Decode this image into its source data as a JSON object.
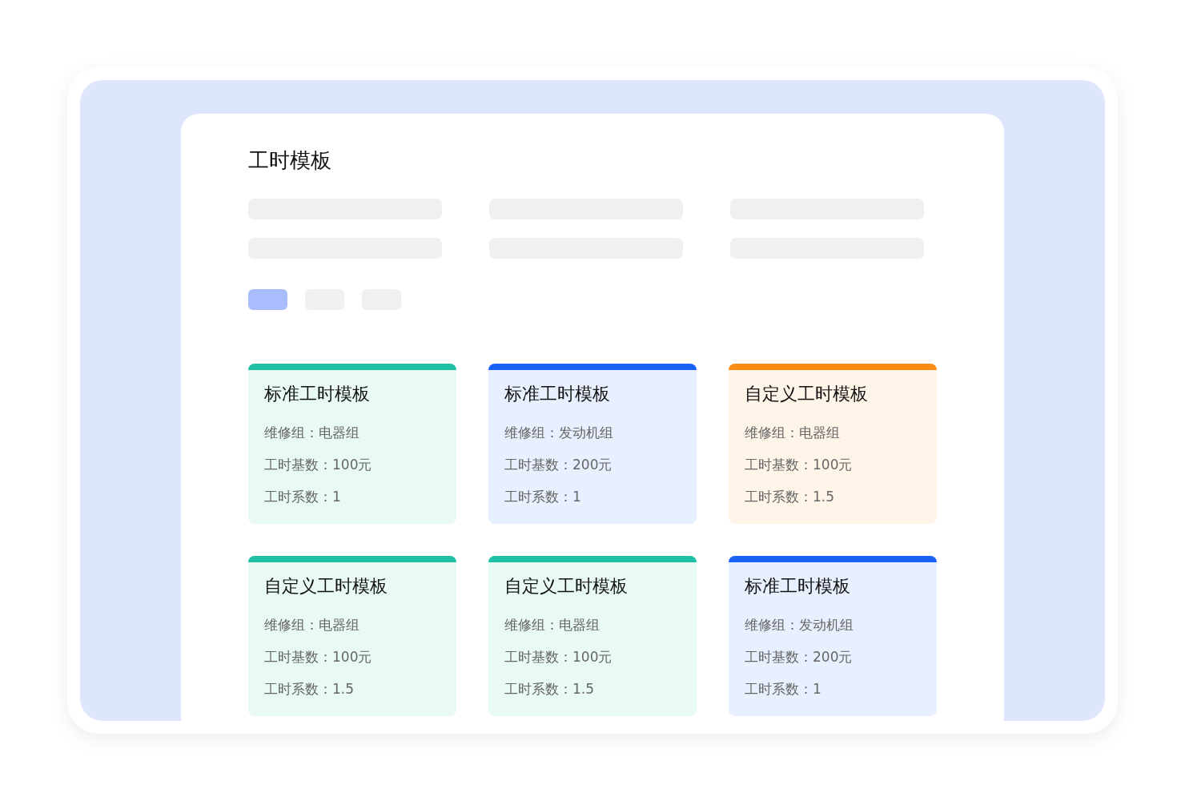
{
  "title": "工时模板",
  "filters": [
    {
      "selected": true
    },
    {
      "selected": false
    },
    {
      "selected": false
    }
  ],
  "cards": [
    {
      "title": "标准工时模板",
      "color": "#20c0a5",
      "lines": [
        "维修组：电器组",
        "工时基数：100元",
        "工时系数：1"
      ]
    },
    {
      "title": "标准工时模板",
      "color": "#1a62fa",
      "lines": [
        "维修组：发动机组",
        "工时基数：200元",
        "工时系数：1"
      ]
    },
    {
      "title": "自定义工时模板",
      "color": "#fa8c16",
      "lines": [
        "维修组：电器组",
        "工时基数：100元",
        "工时系数：1.5"
      ]
    },
    {
      "title": "自定义工时模板",
      "color": "#20c0a5",
      "lines": [
        "维修组：电器组",
        "工时基数：100元",
        "工时系数：1.5"
      ]
    },
    {
      "title": "自定义工时模板",
      "color": "#20c0a5",
      "lines": [
        "维修组：电器组",
        "工时基数：100元",
        "工时系数：1.5"
      ]
    },
    {
      "title": "标准工时模板",
      "color": "#1a62fa",
      "lines": [
        "维修组：发动机组",
        "工时基数：200元",
        "工时系数：1"
      ]
    }
  ]
}
